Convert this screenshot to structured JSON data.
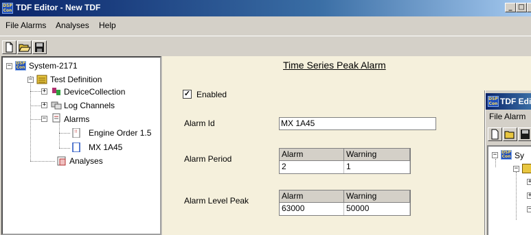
{
  "window": {
    "title": "TDF Editor - New TDF",
    "app_icon_text": "DSP Con"
  },
  "menu": [
    "File",
    "Alarms",
    "Analyses",
    "Help"
  ],
  "toolbar": {
    "buttons": [
      "new-document-icon",
      "open-folder-icon",
      "save-disk-icon"
    ]
  },
  "tree": {
    "root": "System-2171",
    "test_definition": "Test Definition",
    "device_collection": "DeviceCollection",
    "log_channels": "Log Channels",
    "alarms": "Alarms",
    "alarm_engine_order": "Engine Order 1.5",
    "alarm_mx": "MX 1A45",
    "analyses": "Analyses"
  },
  "panel": {
    "title": "Time Series Peak Alarm",
    "enabled_label": "Enabled",
    "enabled_checked": true,
    "alarm_id_label": "Alarm Id",
    "alarm_id_value": "MX 1A45",
    "alarm_period_label": "Alarm Period",
    "alarm_period": {
      "headers": [
        "Alarm",
        "Warning"
      ],
      "values": [
        "2",
        "1"
      ]
    },
    "alarm_level_label": "Alarm Level Peak",
    "alarm_level": {
      "headers": [
        "Alarm",
        "Warning"
      ],
      "values": [
        "63000",
        "50000"
      ]
    }
  },
  "second_window": {
    "title": "TDF Edi",
    "menu": [
      "File",
      "Alarm"
    ],
    "tree_root": "Sy"
  }
}
